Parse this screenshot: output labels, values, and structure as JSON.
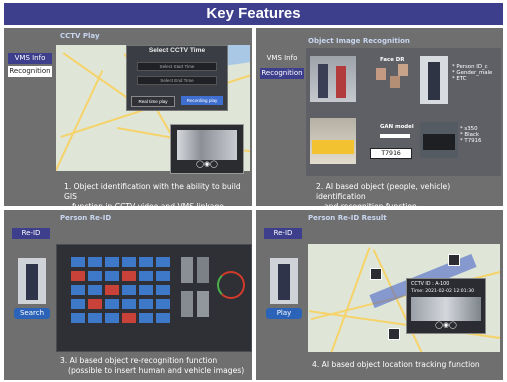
{
  "title": "Key Features",
  "colors": {
    "title_bg": "#3d3f8c",
    "panel_bg": "#6f6f6f",
    "sidebar_active": "#3d3f8c",
    "accent_blue": "#2b63b8",
    "accent_red": "#d0302a"
  },
  "panel1": {
    "header": "CCTV Play",
    "side_vms": "VMS Info",
    "side_recog": "Recognition",
    "dialog_title": "Select CCTV Time",
    "start_time": "Select Start Time",
    "end_time": "Select End Time",
    "btn_real": "Real time play",
    "btn_record": "Recording play",
    "caption_line1": "1. Object identification with the ability to build GIS",
    "caption_line2": "function in CCTV video and VMS linkage"
  },
  "panel2": {
    "header": "Object Image Recognition",
    "side_vms": "VMS Info",
    "side_recog": "Recognition",
    "face_dr": "Face DR",
    "attrs_person": [
      "* Person ID_c",
      "* Gender_male",
      "* ETC"
    ],
    "gan_model": "GAN model",
    "plate": "T7916",
    "attrs_vehicle": [
      "* s350",
      "* Black",
      "* T7916"
    ],
    "caption_line1": "2. AI based object (people, vehicle) identification",
    "caption_line2": "and recognition function"
  },
  "panel3": {
    "header": "Person Re-ID",
    "side_tab": "Re-ID",
    "search": "Search",
    "caption_line1": "3. AI based object re-recognition function",
    "caption_line2": "(possible to insert human and vehicle images)"
  },
  "panel4": {
    "header": "Person Re-ID Result",
    "side_tab": "Re-ID",
    "play": "Play",
    "cctv_id": "CCTV ID : A-100",
    "time": "Time: 2021-02-02 12:01:30",
    "caption_line1": "4. AI based object location tracking function"
  }
}
